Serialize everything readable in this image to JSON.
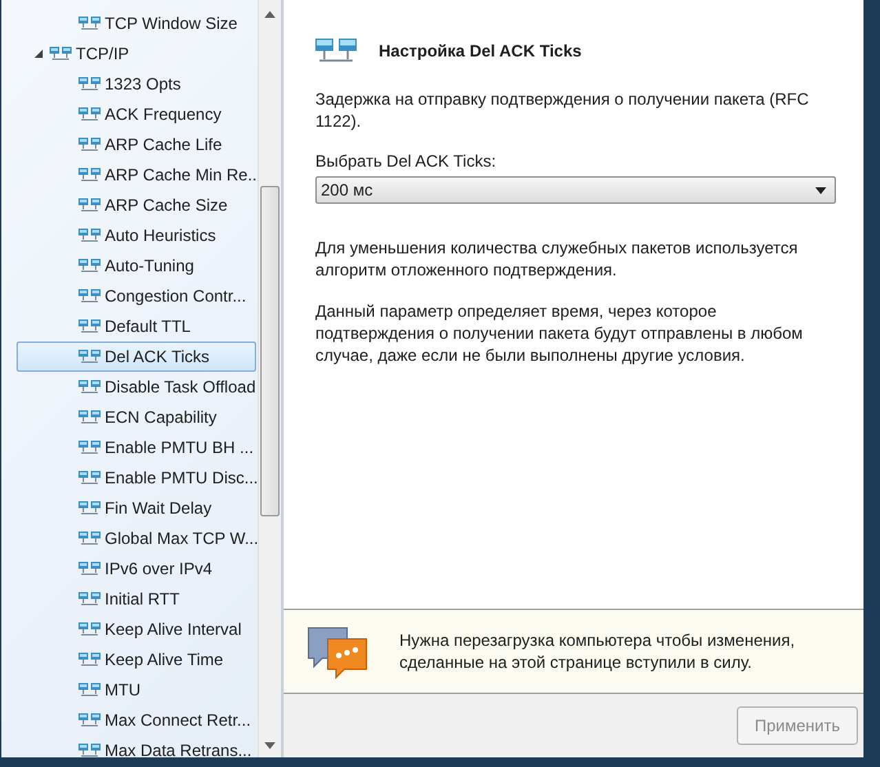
{
  "tree": {
    "partial_group": [
      {
        "label": "TCP Window Size",
        "selected": false
      }
    ],
    "nodes": [
      {
        "label": "TCP/IP",
        "expanded": true,
        "selected": false,
        "children": [
          {
            "label": "1323 Opts",
            "selected": false
          },
          {
            "label": "ACK Frequency",
            "selected": false
          },
          {
            "label": "ARP Cache Life",
            "selected": false
          },
          {
            "label": "ARP Cache Min Re...",
            "selected": false
          },
          {
            "label": "ARP Cache Size",
            "selected": false
          },
          {
            "label": "Auto Heuristics",
            "selected": false
          },
          {
            "label": "Auto-Tuning",
            "selected": false
          },
          {
            "label": "Congestion Contr...",
            "selected": false
          },
          {
            "label": "Default TTL",
            "selected": false
          },
          {
            "label": "Del ACK Ticks",
            "selected": true
          },
          {
            "label": "Disable Task Offload",
            "selected": false
          },
          {
            "label": "ECN Capability",
            "selected": false
          },
          {
            "label": "Enable PMTU BH ...",
            "selected": false
          },
          {
            "label": "Enable PMTU Disc...",
            "selected": false
          },
          {
            "label": "Fin Wait Delay",
            "selected": false
          },
          {
            "label": "Global Max TCP W...",
            "selected": false
          },
          {
            "label": "IPv6 over IPv4",
            "selected": false
          },
          {
            "label": "Initial RTT",
            "selected": false
          },
          {
            "label": "Keep Alive Interval",
            "selected": false
          },
          {
            "label": "Keep Alive Time",
            "selected": false
          },
          {
            "label": "MTU",
            "selected": false
          },
          {
            "label": "Max Connect Retr...",
            "selected": false
          },
          {
            "label": "Max Data Retrans...",
            "selected": false
          }
        ]
      }
    ]
  },
  "panel": {
    "title": "Настройка Del ACK Ticks",
    "description": "Задержка на отправку подтверждения о получении пакета (RFC 1122).",
    "select_label": "Выбрать Del ACK Ticks:",
    "select_value": "200 мс",
    "paragraphs": [
      "Для уменьшения количества служебных пакетов используется алгоритм отложенного подтверждения.",
      "Данный параметр определяет время, через которое подтверждения о получении пакета будут отправлены в любом случае, даже если не были выполнены другие условия."
    ]
  },
  "notice": {
    "text": "Нужна перезагрузка компьютера чтобы изменения, сделанные на этой странице вступили в силу."
  },
  "apply_button": {
    "label": "Применить",
    "disabled": true
  }
}
